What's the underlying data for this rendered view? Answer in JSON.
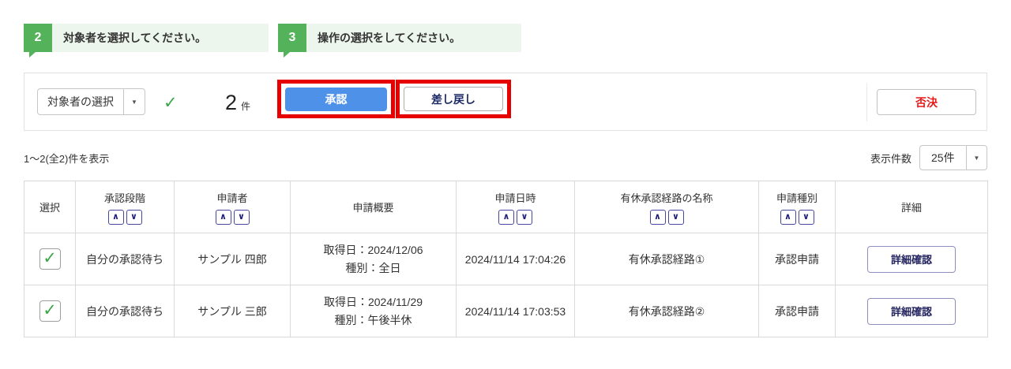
{
  "steps": [
    {
      "number": "2",
      "label": "対象者を選択してください。"
    },
    {
      "number": "3",
      "label": "操作の選択をしてください。"
    }
  ],
  "toolbar": {
    "target_select_label": "対象者の選択",
    "count_value": "2",
    "count_unit": "件",
    "approve_label": "承認",
    "send_back_label": "差し戻し",
    "reject_label": "否決"
  },
  "list_info": {
    "range_text": "1〜2(全2)件を表示",
    "page_size_label": "表示件数",
    "page_size_value": "25件"
  },
  "icons": {
    "caret_down": "▼",
    "check": "✓",
    "sort_asc": "∧",
    "sort_desc": "∨"
  },
  "table": {
    "headers": [
      {
        "label": "選択"
      },
      {
        "label": "承認段階"
      },
      {
        "label": "申請者"
      },
      {
        "label": "申請概要"
      },
      {
        "label": "申請日時"
      },
      {
        "label": "有休承認経路の名称"
      },
      {
        "label": "申請種別"
      },
      {
        "label": "詳細"
      }
    ],
    "rows": [
      {
        "checked": true,
        "approval_stage": "自分の承認待ち",
        "applicant": "サンプル 四郎",
        "summary_line1": "取得日：2024/12/06",
        "summary_line2": "種別：全日",
        "datetime": "2024/11/14 17:04:26",
        "route_name": "有休承認経路①",
        "request_type": "承認申請",
        "detail_button": "詳細確認"
      },
      {
        "checked": true,
        "approval_stage": "自分の承認待ち",
        "applicant": "サンプル 三郎",
        "summary_line1": "取得日：2024/11/29",
        "summary_line2": "種別：午後半休",
        "datetime": "2024/11/14 17:03:53",
        "route_name": "有休承認経路②",
        "request_type": "承認申請",
        "detail_button": "詳細確認"
      }
    ]
  },
  "colors": {
    "accent-green": "#54b25b",
    "light-green": "#edf6ec",
    "check-green": "#3aa54a",
    "approve-blue": "#4d92e8",
    "annotation-red": "#e60000",
    "reject-red": "#e61717",
    "navy-text": "#1c2a66"
  }
}
